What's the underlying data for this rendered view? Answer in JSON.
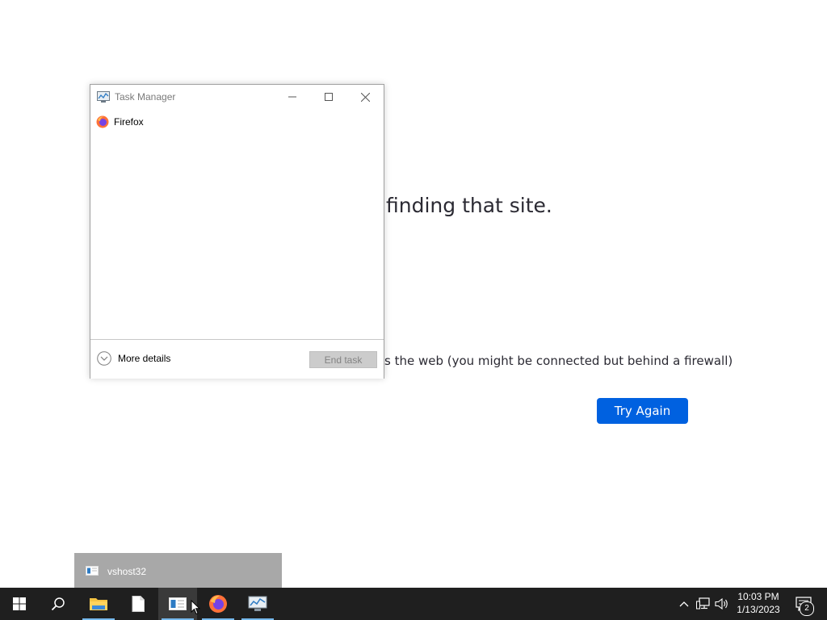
{
  "browser_page": {
    "error_heading_partial": "finding that site.",
    "error_detail_partial": "s the web (you might be connected but behind a firewall)",
    "try_again_label": "Try Again"
  },
  "task_manager": {
    "title": "Task Manager",
    "processes": [
      {
        "name": "Firefox",
        "icon": "firefox-icon"
      }
    ],
    "more_details_label": "More details",
    "end_task_label": "End task"
  },
  "thumbnail_popup": {
    "label": "vshost32",
    "icon": "window-icon"
  },
  "taskbar": {
    "pinned": [
      {
        "name": "start",
        "icon": "windows-logo-icon"
      },
      {
        "name": "search",
        "icon": "search-icon"
      },
      {
        "name": "file-explorer",
        "icon": "folder-icon"
      },
      {
        "name": "document",
        "icon": "document-icon"
      },
      {
        "name": "vshost32",
        "icon": "window-icon"
      },
      {
        "name": "firefox",
        "icon": "firefox-icon"
      },
      {
        "name": "task-manager",
        "icon": "task-manager-icon"
      }
    ],
    "clock_time": "10:03 PM",
    "clock_date": "1/13/2023",
    "notification_count": "2",
    "accent_color": "#76b9ed"
  },
  "colors": {
    "try_again_bg": "#0061e0",
    "taskbar_bg": "#1f1f1f"
  }
}
